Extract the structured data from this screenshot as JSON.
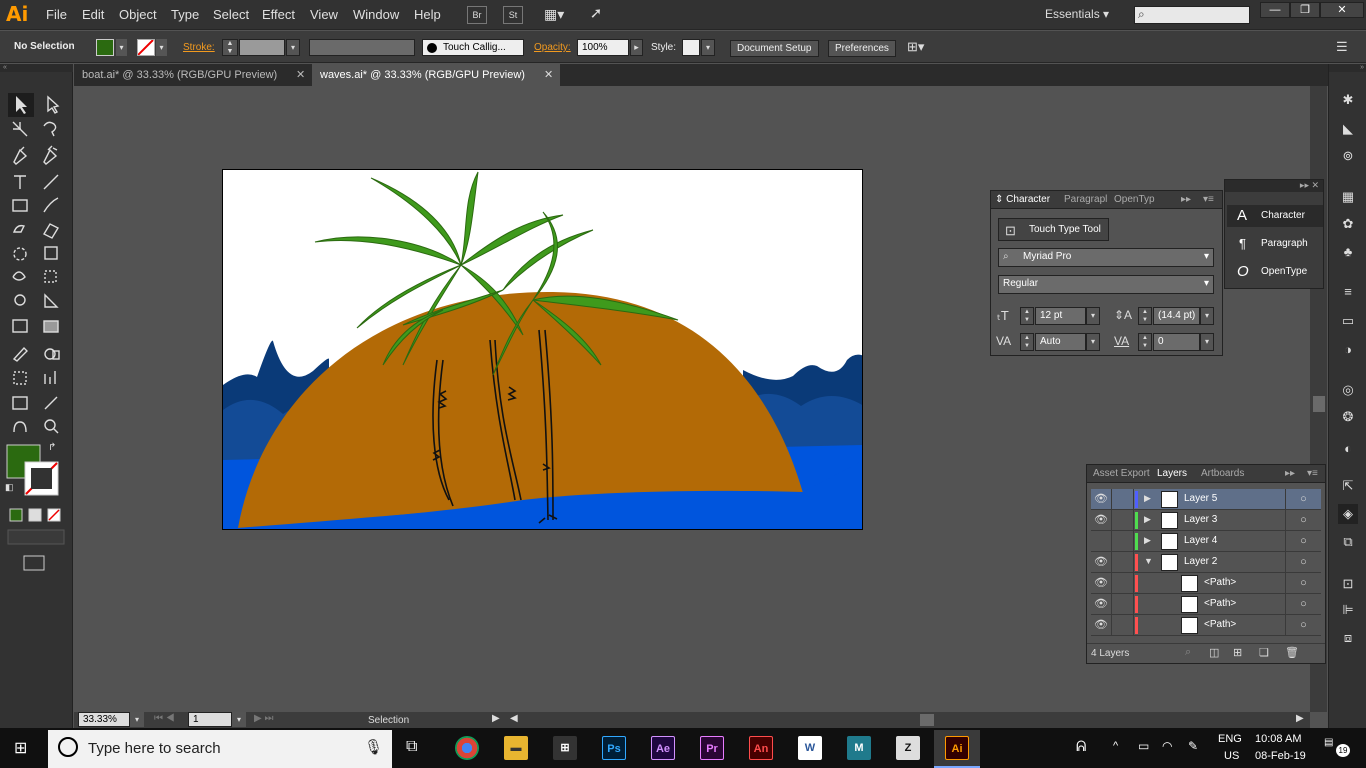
{
  "app": {
    "logo": "Ai",
    "workspace": "Essentials",
    "menus": [
      "File",
      "Edit",
      "Object",
      "Type",
      "Select",
      "Effect",
      "View",
      "Window",
      "Help"
    ],
    "bridge": "Br",
    "stock": "St"
  },
  "control": {
    "selection": "No Selection",
    "stroke_label": "Stroke:",
    "brush": "Touch Callig...",
    "opacity_label": "Opacity:",
    "opacity": "100%",
    "style_label": "Style:",
    "document_setup": "Document Setup",
    "preferences": "Preferences",
    "fill_color": "#2b6a10",
    "stroke_color": "#ffffff"
  },
  "tabs": [
    {
      "label": "boat.ai* @ 33.33% (RGB/GPU Preview)"
    },
    {
      "label": "waves.ai* @ 33.33% (RGB/GPU Preview)"
    }
  ],
  "character": {
    "tabs": [
      "Character",
      "Paragrapl",
      "OpenTyp"
    ],
    "touch_type": "Touch Type Tool",
    "font": "Myriad Pro",
    "style": "Regular",
    "size": "12 pt",
    "leading": "(14.4 pt)",
    "kerning": "Auto",
    "tracking": "0"
  },
  "mini_panel": {
    "items": [
      "Character",
      "Paragraph",
      "OpenType"
    ]
  },
  "layers": {
    "tabs": [
      "Asset Export",
      "Layers",
      "Artboards"
    ],
    "rows": [
      {
        "name": "Layer 5",
        "color": "#4f5fff",
        "expand": "▶",
        "visible": true
      },
      {
        "name": "Layer 3",
        "color": "#4fdc4f",
        "expand": "▶",
        "visible": true
      },
      {
        "name": "Layer 4",
        "color": "#4fdc4f",
        "expand": "▶",
        "visible": false
      },
      {
        "name": "Layer 2",
        "color": "#ff5050",
        "expand": "▼",
        "visible": true
      },
      {
        "name": "<Path>",
        "color": "#ff5050",
        "expand": "",
        "visible": true
      },
      {
        "name": "<Path>",
        "color": "#ff5050",
        "expand": "",
        "visible": true
      },
      {
        "name": "<Path>",
        "color": "#ff5050",
        "expand": "",
        "visible": true
      }
    ],
    "count": "4 Layers"
  },
  "status": {
    "zoom": "33.33%",
    "artboard": "1",
    "tool": "Selection"
  },
  "taskbar": {
    "search": "Type here to search",
    "lang1": "ENG",
    "lang2": "US",
    "time": "10:08 AM",
    "date": "08-Feb-19",
    "notif": "19"
  }
}
